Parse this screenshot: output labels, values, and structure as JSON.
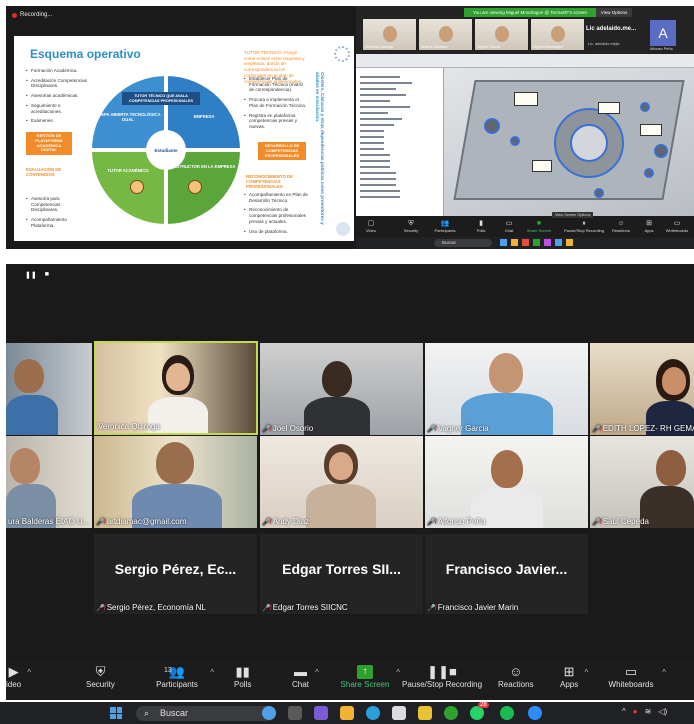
{
  "slide_window": {
    "recording_label": "Recording...",
    "title": "Esquema operativo",
    "left_list": [
      "Formación Académica.",
      "Acreditación Competencias Disciplinares.",
      "Asesorías académicas.",
      "Seguimiento o acreditaciones.",
      "Exámenes."
    ],
    "box_gestion": "GESTIÓN DE PLATAFORMA ACADÉMICA DIGITAL",
    "evaluacion_label": "EVALUACIÓN DE CONTENIDOS",
    "left_list_bottom": [
      "Asesoría para Competencias Disciplinares.",
      "Acompañamiento Plataforma."
    ],
    "tutor_tecnico_header": "TUTOR TÉCNICO: Fungir como enlace entre empresa y empleado, dando de correspondencia los contenidos en el plan de competencias profesionales.",
    "right_list": [
      "Establecer Plan de Formación Técnica (matriz de correspondencia).",
      "Procura e implementa el Plan de Formación Técnica.",
      "Registra en plataforma competencias previas y nuevas."
    ],
    "desarrollo_label": "DESARROLLO DE COMPETENCIAS PROFESIONALES",
    "reconocimiento_label": "RECONOCIMIENTO DE COMPETENCIAS PROFESIONALES",
    "right_list_bottom": [
      "Acompañamiento en Plan de Desarrollo Técnico.",
      "Reconocimiento de competencias profesionales previas y actuales.",
      "Uso de plataforma."
    ],
    "wheel": {
      "center_tag": "TUTOR TÉCNICO QUE AVALA COMPETENCIAS PROFESIONALES",
      "tl": "PREPA ABIERTA TECNOLÓGICA DUAL",
      "tr": "EMPRESA",
      "bl": "TUTOR ACADÉMICO",
      "br": "INSTRUCTOR EN LA EMPRESA",
      "center": "Estudiante"
    },
    "vertical_text": "Clústers, Cámaras y otras dependencias públicas como promotores y aliados en vinculación."
  },
  "share_window": {
    "banner": "You are viewing Miguel Mondragon @ TecSaOF's screen",
    "view_options": "View Options",
    "mini_tiles": [
      "Veronica Quiroga",
      "Andrés Sánchez",
      "Vagner García",
      "Miguel Mondragón"
    ],
    "mini_name_lic": "Lic adelaido.me...",
    "mini_name_lic_sub": "Lic. adelaido mejia",
    "mini_name_alfonso": "Alfonso Peña",
    "avatar_letter": "A",
    "toolbar": [
      "Video",
      "Security",
      "Participants",
      "Polls",
      "Chat",
      "Share Screen",
      "Pause/Stop Recording",
      "Reactions",
      "Apps",
      "Whiteboards"
    ],
    "share_toolbar_label": "View Screen Options",
    "search_label": "Buscar"
  },
  "gallery": {
    "row1": [
      "",
      "Veronica Quiroga",
      "Joel Osorio",
      "Vagner Garcia",
      "EDITH LOPEZ- RH GEMAI"
    ],
    "row2": [
      "ura Balderas EIAO U...",
      "artdiamac@gmail.com",
      "Andy Diaz",
      "Alfonso Peña",
      "Saul Cepeda"
    ],
    "text_tiles": [
      {
        "big": "Sergio Pérez, Ec...",
        "small": "Sergio Pérez, Economía NL"
      },
      {
        "big": "Edgar Torres SII...",
        "small": "Edgar Torres SIICNC"
      },
      {
        "big": "Francisco Javier...",
        "small": "Francisco Javier Marin"
      }
    ]
  },
  "toolbar": {
    "video": "ideo",
    "security": "Security",
    "participants": "Participants",
    "participants_count": "13",
    "polls": "Polls",
    "chat": "Chat",
    "share_screen": "Share Screen",
    "recording": "Pause/Stop Recording",
    "reactions": "Reactions",
    "apps": "Apps",
    "whiteboards": "Whiteboards",
    "share_color": "#2ea12e"
  },
  "taskbar": {
    "search_label": "Buscar",
    "notif_badge": "28"
  }
}
